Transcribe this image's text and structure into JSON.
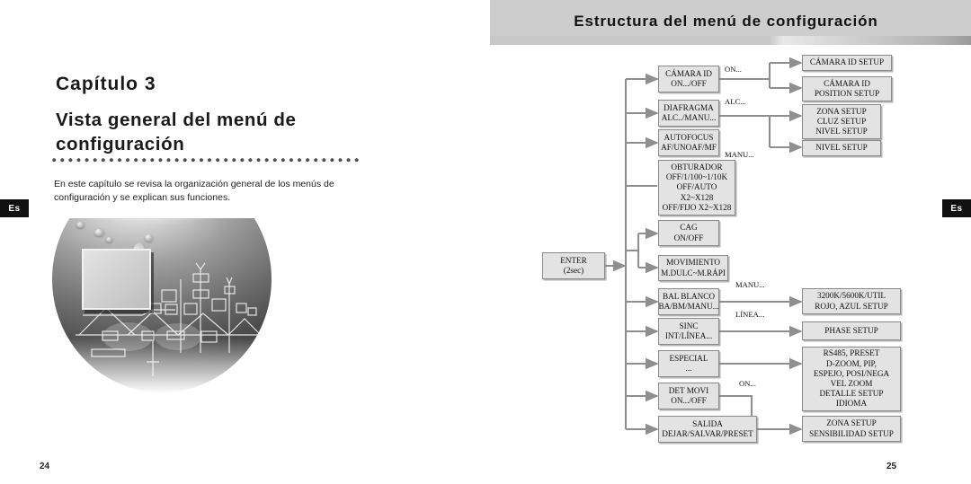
{
  "left_page": {
    "chapter_label": "Capítulo  3",
    "chapter_title": "Vista general del menú de configuración",
    "intro": "En este capítulo se revisa la organización general de los menús de configuración y se explican sus funciones.",
    "language_tab": "Es",
    "page_number": "24"
  },
  "right_page": {
    "header_title": "Estructura del menú de configuración",
    "language_tab": "Es",
    "page_number": "25"
  },
  "diagram": {
    "root": {
      "line1": "ENTER",
      "line2": "(2sec)"
    },
    "level1": [
      {
        "id": "camara-id",
        "lines": [
          "CÁMARA ID",
          "ON.../OFF"
        ]
      },
      {
        "id": "diafragma",
        "lines": [
          "DIAFRAGMA",
          "ALC../MANU..."
        ]
      },
      {
        "id": "autofocus",
        "lines": [
          "AUTOFOCUS",
          "AF/UNOAF/MF"
        ]
      },
      {
        "id": "obturador",
        "lines": [
          "OBTURADOR",
          "OFF/1/100~1/10K",
          "OFF/AUTO",
          "X2~X128",
          "OFF/FIJO X2~X128"
        ]
      },
      {
        "id": "cag",
        "lines": [
          "CAG",
          "ON/OFF"
        ]
      },
      {
        "id": "movimiento",
        "lines": [
          "MOVIMIENTO",
          "M.DULC~M.RÁPI"
        ]
      },
      {
        "id": "bal-blanco",
        "lines": [
          "BAL BLANCO",
          "BA/BM/MANU..."
        ]
      },
      {
        "id": "sinc",
        "lines": [
          "SINC",
          "INT/LÍNEA..."
        ]
      },
      {
        "id": "especial",
        "lines": [
          "ESPECIAL",
          "..."
        ]
      },
      {
        "id": "det-movi",
        "lines": [
          "DET MOVI",
          "ON.../OFF"
        ]
      },
      {
        "id": "salida",
        "lines": [
          "SALIDA",
          "DEJAR/SALVAR/PRESET"
        ]
      }
    ],
    "level2": [
      {
        "id": "camara-id-setup",
        "lines": [
          "CÁMARA ID SETUP"
        ]
      },
      {
        "id": "camara-id-position",
        "lines": [
          "CÁMARA ID",
          "POSITION SETUP"
        ]
      },
      {
        "id": "zona-cluz-nivel",
        "lines": [
          "ZONA SETUP",
          "CLUZ SETUP",
          "NIVEL SETUP"
        ]
      },
      {
        "id": "nivel-setup",
        "lines": [
          "NIVEL SETUP"
        ]
      },
      {
        "id": "color-temp",
        "lines": [
          "3200K/5600K/UTIL",
          "ROJO, AZUL SETUP"
        ]
      },
      {
        "id": "phase-setup",
        "lines": [
          "PHASE SETUP"
        ]
      },
      {
        "id": "especial-setup",
        "lines": [
          "RS485, PRESET",
          "D-ZOOM, PIP,",
          "ESPEJO, POSI/NEGA",
          "VEL ZOOM",
          "DETALLE SETUP",
          "IDIOMA"
        ]
      },
      {
        "id": "zona-sensibilidad",
        "lines": [
          "ZONA SETUP",
          "SENSIBILIDAD SETUP"
        ]
      }
    ],
    "edge_labels": [
      {
        "id": "edge-on-camara",
        "text": "ON..."
      },
      {
        "id": "edge-alc",
        "text": "ALC..."
      },
      {
        "id": "edge-manu-diaf",
        "text": "MANU..."
      },
      {
        "id": "edge-manu-bal",
        "text": "MANU..."
      },
      {
        "id": "edge-linea",
        "text": "LÍNEA..."
      },
      {
        "id": "edge-on-det",
        "text": "ON..."
      }
    ]
  },
  "colors": {
    "node_fill": "#e3e3e3",
    "node_border": "#8a8a8a",
    "connector": "#8f8f8f",
    "header_band": "#cdcdcd",
    "tab_bg": "#111111"
  }
}
